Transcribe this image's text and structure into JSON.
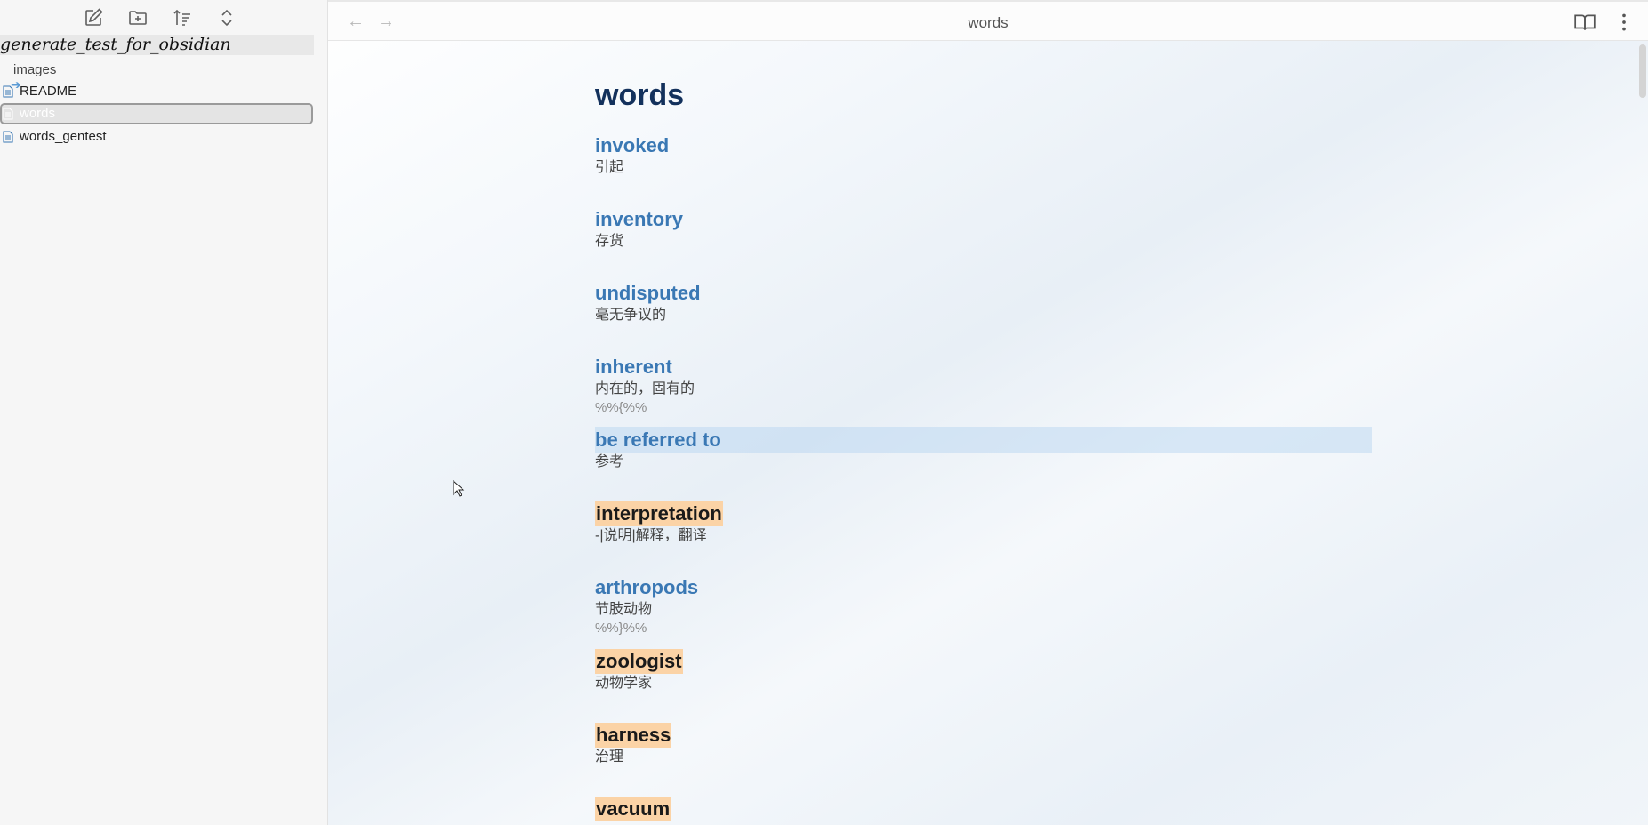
{
  "sidebar": {
    "toolbar": {
      "new_note_icon": "edit-icon",
      "new_folder_icon": "folder-plus-icon",
      "sort_icon": "sort-icon",
      "collapse_icon": "chevron-up-down-icon"
    },
    "vault_name": "generate_test_for_obsidian",
    "items": [
      {
        "label": "images",
        "type": "folder"
      },
      {
        "label": "README",
        "type": "file"
      },
      {
        "label": "words",
        "type": "file",
        "active": true
      },
      {
        "label": "words_gentest",
        "type": "file"
      }
    ]
  },
  "header": {
    "title": "words",
    "back_icon": "arrow-left-icon",
    "forward_icon": "arrow-right-icon",
    "reading_view_icon": "book-open-icon",
    "more_icon": "more-vertical-icon"
  },
  "document": {
    "heading": "words",
    "entries": [
      {
        "word": "invoked",
        "meaning": "引起"
      },
      {
        "word": "inventory",
        "meaning": "存货"
      },
      {
        "word": "undisputed",
        "meaning": "毫无争议的"
      },
      {
        "word": "inherent",
        "meaning": "内在的，固有的",
        "comment": "%%{%%"
      },
      {
        "word": "be referred to",
        "meaning": "参考"
      },
      {
        "word": "interpretation",
        "meaning": "-|说明|解释，翻译"
      },
      {
        "word": "arthropods",
        "meaning": "节肢动物",
        "comment": "%%}%%"
      },
      {
        "word": "zoologist",
        "meaning": "动物学家"
      },
      {
        "word": "harness",
        "meaning": "治理"
      },
      {
        "word": "vacuum",
        "meaning": ""
      }
    ]
  },
  "colors": {
    "link_word": "#3a78b4",
    "highlight": "#fbd3a6",
    "heading": "#13315c"
  }
}
